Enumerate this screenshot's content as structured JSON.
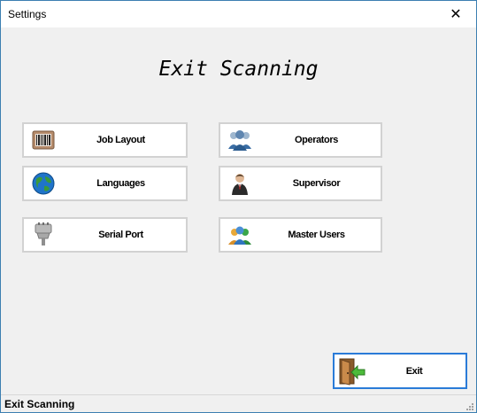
{
  "window": {
    "title": "Settings",
    "close_glyph": "✕"
  },
  "heading": "Exit Scanning",
  "buttons": [
    {
      "label": "Job Layout",
      "icon": "barcode-icon"
    },
    {
      "label": "Operators",
      "icon": "operators-icon"
    },
    {
      "label": "Languages",
      "icon": "globe-icon"
    },
    {
      "label": "Supervisor",
      "icon": "supervisor-icon"
    },
    {
      "label": "Serial Port",
      "icon": "serial-port-icon"
    },
    {
      "label": "Master Users",
      "icon": "master-users-icon"
    }
  ],
  "exit": {
    "label": "Exit",
    "icon": "exit-door-icon"
  },
  "status": {
    "text": "Exit Scanning"
  },
  "colors": {
    "accent": "#2a7bd8",
    "window_border": "#3c7fb1",
    "background": "#f0f0f0"
  }
}
